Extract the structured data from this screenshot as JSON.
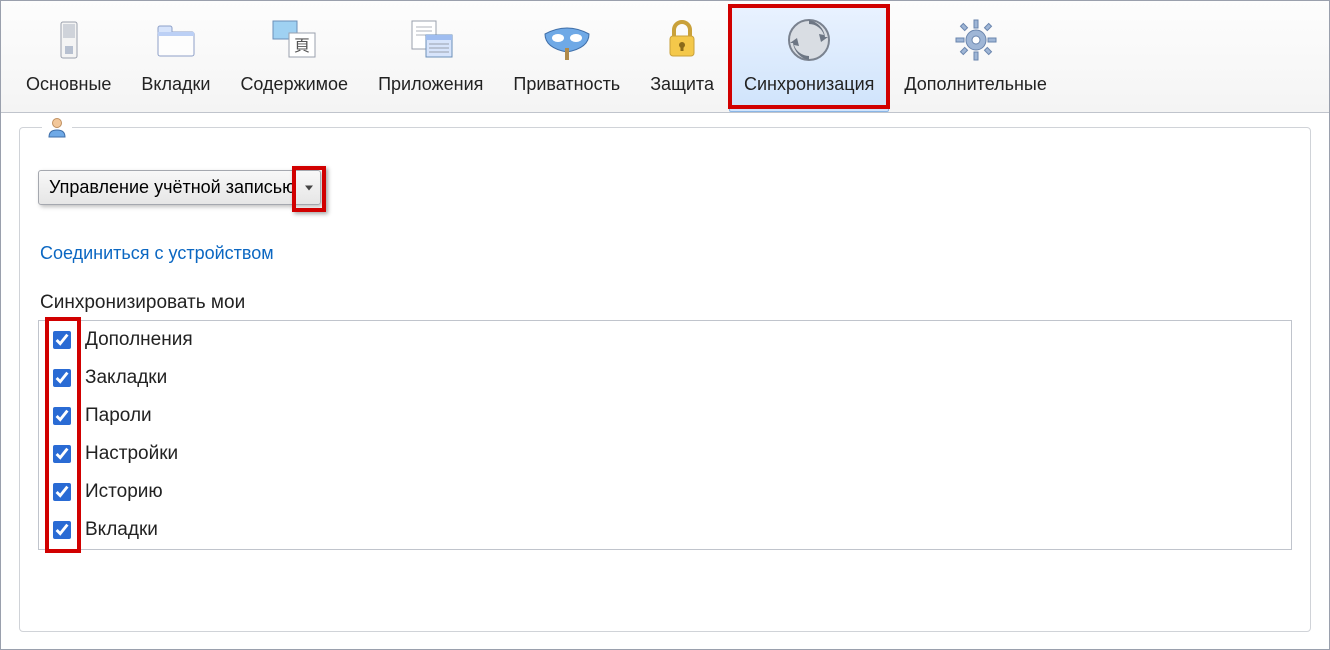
{
  "toolbar": {
    "items": [
      {
        "id": "general",
        "label": "Основные",
        "selected": false
      },
      {
        "id": "tabs",
        "label": "Вкладки",
        "selected": false
      },
      {
        "id": "content",
        "label": "Содержимое",
        "selected": false
      },
      {
        "id": "applications",
        "label": "Приложения",
        "selected": false
      },
      {
        "id": "privacy",
        "label": "Приватность",
        "selected": false
      },
      {
        "id": "security",
        "label": "Защита",
        "selected": false
      },
      {
        "id": "sync",
        "label": "Синхронизация",
        "selected": true
      },
      {
        "id": "advanced",
        "label": "Дополнительные",
        "selected": false
      }
    ]
  },
  "panel": {
    "account_dropdown_label": "Управление учётной записью",
    "pair_device_link": "Соединиться с устройством",
    "sync_heading": "Синхронизировать мои",
    "checks": [
      {
        "id": "addons",
        "label": "Дополнения",
        "checked": true
      },
      {
        "id": "bookmarks",
        "label": "Закладки",
        "checked": true
      },
      {
        "id": "passwords",
        "label": "Пароли",
        "checked": true
      },
      {
        "id": "prefs",
        "label": "Настройки",
        "checked": true
      },
      {
        "id": "history",
        "label": "Историю",
        "checked": true
      },
      {
        "id": "tabs",
        "label": "Вкладки",
        "checked": true
      }
    ]
  },
  "colors": {
    "highlight": "#d10000",
    "link": "#0b67c2",
    "selected_bg": "#cfe3fb"
  }
}
